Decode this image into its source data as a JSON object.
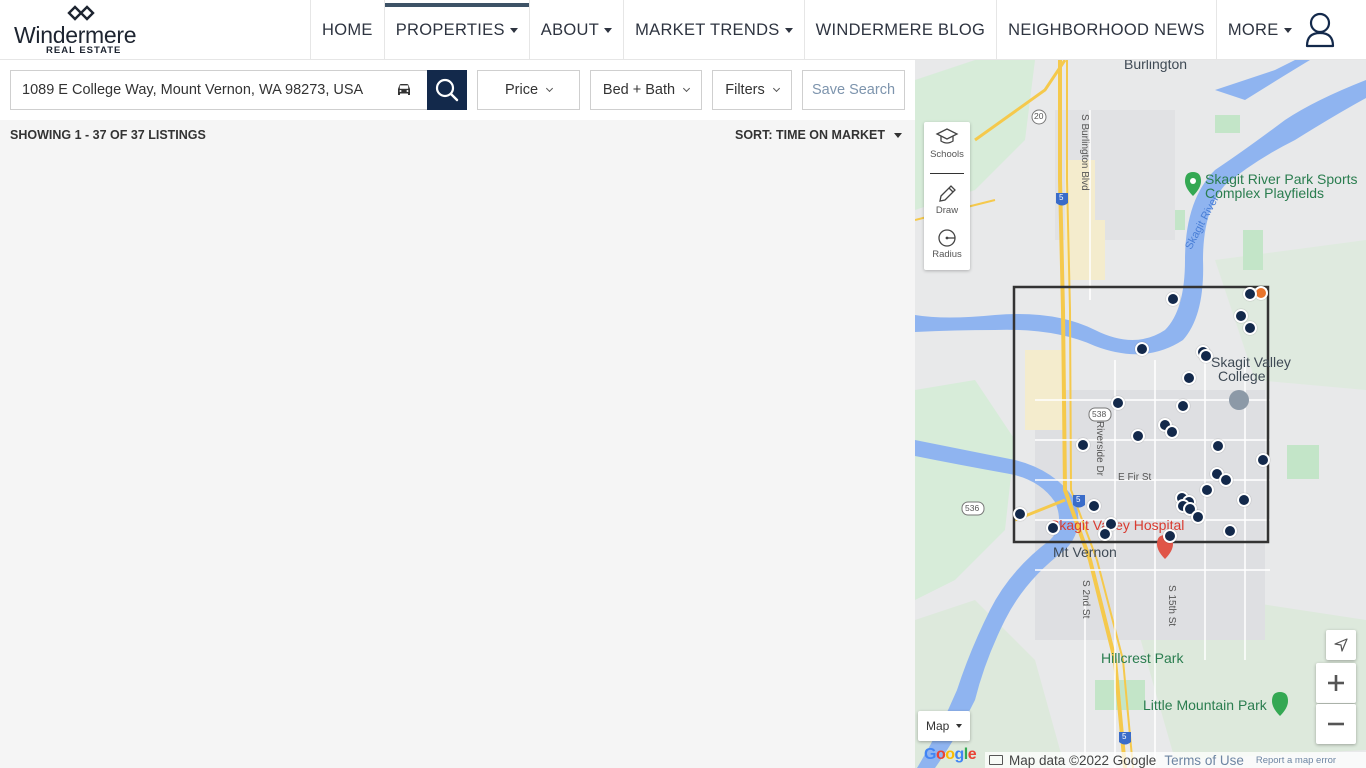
{
  "brand": {
    "name": "Windermere",
    "subtitle": "REAL ESTATE"
  },
  "nav": {
    "items": [
      {
        "label": "HOME",
        "dropdown": false,
        "active": false
      },
      {
        "label": "PROPERTIES",
        "dropdown": true,
        "active": true
      },
      {
        "label": "ABOUT",
        "dropdown": true,
        "active": false
      },
      {
        "label": "MARKET TRENDS",
        "dropdown": true,
        "active": false
      },
      {
        "label": "WINDERMERE BLOG",
        "dropdown": false,
        "active": false
      },
      {
        "label": "NEIGHBORHOOD NEWS",
        "dropdown": false,
        "active": false
      },
      {
        "label": "MORE",
        "dropdown": true,
        "active": false
      }
    ],
    "user_icon": "user-icon"
  },
  "search": {
    "value": "1089 E College Way, Mount Vernon, WA 98273, USA",
    "commute_icon": "car-icon",
    "search_icon": "search-icon"
  },
  "filters": {
    "price": "Price",
    "bed_bath": "Bed + Bath",
    "filters": "Filters",
    "save_search": "Save Search"
  },
  "results": {
    "showing": "SHOWING 1 - 37 OF 37 LISTINGS",
    "sort": "SORT: TIME ON MARKET"
  },
  "map": {
    "tools": {
      "schools": "Schools",
      "draw": "Draw",
      "radius": "Radius"
    },
    "labels": {
      "burlington": "Burlington",
      "skagit_river_park": "Skagit River Park Sports",
      "skagit_river_park_2": "Complex Playfields",
      "skagit_river": "Skagit River",
      "skagit_valley_college": "Skagit Valley",
      "skagit_valley_college_2": "College",
      "skagit_valley_hospital": "Skagit Valley Hospital",
      "mt_vernon": "Mt Vernon",
      "hillcrest_park": "Hillcrest Park",
      "little_mountain_park": "Little Mountain Park",
      "s_burlington_blvd": "S Burlington Blvd",
      "riverside_dr": "Riverside Dr",
      "e_fir_st": "E Fir St",
      "s_2nd_st": "S 2nd St",
      "s_15th_st": "S 15th St",
      "route_20": "20",
      "route_538": "538",
      "route_536": "536",
      "i5_a": "5",
      "i5_b": "5",
      "i5_c": "5"
    },
    "map_type": "Map",
    "zoom_in": "+",
    "zoom_out": "−",
    "attribution": {
      "data": "Map data ©2022 Google",
      "terms": "Terms of Use",
      "report": "Report a map error"
    },
    "google": [
      "G",
      "o",
      "o",
      "g",
      "l",
      "e"
    ]
  },
  "colors": {
    "navy": "#13294b",
    "pin_orange": "#e8742b",
    "water": "#8fb4f0",
    "park": "#c3e5c8",
    "highway": "#f5c94c"
  }
}
